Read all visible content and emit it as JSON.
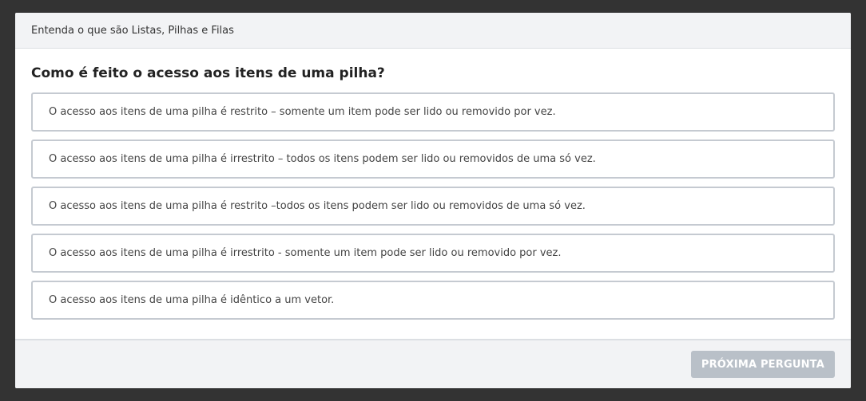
{
  "header": {
    "title": "Entenda o que são Listas, Pilhas e Filas"
  },
  "question": {
    "text": "Como é feito o acesso aos itens de uma pilha?"
  },
  "options": [
    {
      "label": "O acesso aos itens de uma pilha é restrito – somente um item pode ser lido ou removido por vez."
    },
    {
      "label": "O acesso aos itens de uma pilha é irrestrito – todos os itens podem ser lido ou removidos de uma só vez."
    },
    {
      "label": "O acesso aos itens de uma pilha é restrito –todos os itens podem ser lido ou removidos de uma só vez."
    },
    {
      "label": "O acesso aos itens de uma pilha é irrestrito - somente um item pode ser lido ou removido por vez."
    },
    {
      "label": "O acesso aos itens de uma pilha é idêntico a um vetor."
    }
  ],
  "footer": {
    "next_label": "PRÓXIMA PERGUNTA"
  },
  "colors": {
    "backdrop": "#333333",
    "header_bg": "#f2f3f5",
    "option_border": "#c5cad1",
    "button_disabled": "#b9c0c8"
  }
}
